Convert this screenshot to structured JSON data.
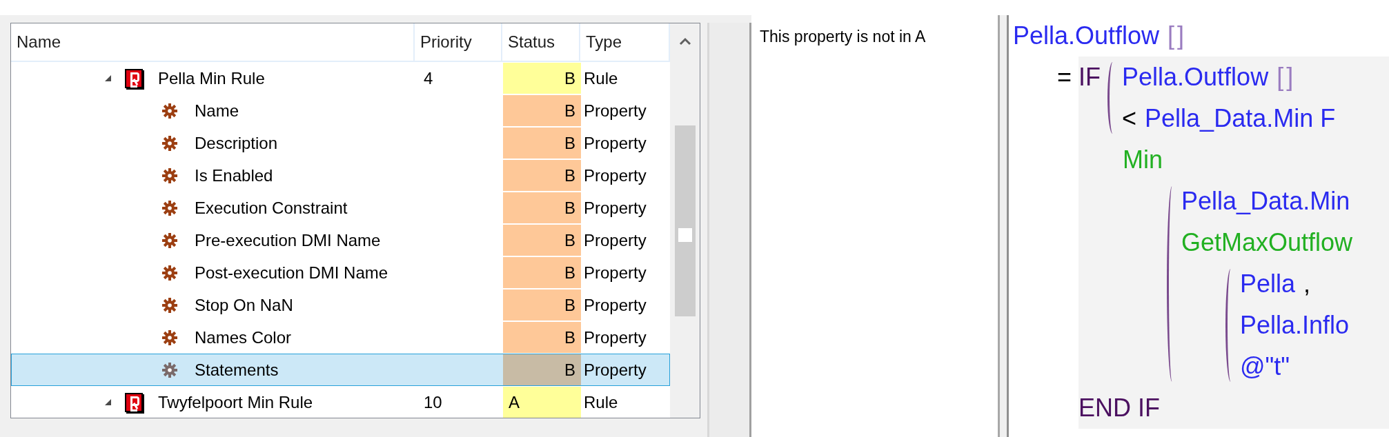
{
  "tree": {
    "columns": [
      "Name",
      "Priority",
      "Status",
      "Type"
    ],
    "rows": [
      {
        "kind": "rule",
        "name": "Pella Min Rule",
        "priority": "4",
        "status": {
          "text": "B",
          "aligned_right": true
        },
        "color": "#ffff99",
        "type": "Rule",
        "expanded": true,
        "selected": false,
        "children": [
          {
            "kind": "property",
            "name": "Name",
            "status": {
              "text": "B",
              "aligned_right": true
            },
            "color": "#fec898",
            "type": "Property",
            "selected": false
          },
          {
            "kind": "property",
            "name": "Description",
            "status": {
              "text": "B",
              "aligned_right": true
            },
            "color": "#fec898",
            "type": "Property",
            "selected": false
          },
          {
            "kind": "property",
            "name": "Is Enabled",
            "status": {
              "text": "B",
              "aligned_right": true
            },
            "color": "#fec898",
            "type": "Property",
            "selected": false
          },
          {
            "kind": "property",
            "name": "Execution Constraint",
            "status": {
              "text": "B",
              "aligned_right": true
            },
            "color": "#fec898",
            "type": "Property",
            "selected": false
          },
          {
            "kind": "property",
            "name": "Pre-execution DMI Name",
            "status": {
              "text": "B",
              "aligned_right": true
            },
            "color": "#fec898",
            "type": "Property",
            "selected": false
          },
          {
            "kind": "property",
            "name": "Post-execution DMI Name",
            "status": {
              "text": "B",
              "aligned_right": true
            },
            "color": "#fec898",
            "type": "Property",
            "selected": false
          },
          {
            "kind": "property",
            "name": "Stop On NaN",
            "status": {
              "text": "B",
              "aligned_right": true
            },
            "color": "#fec898",
            "type": "Property",
            "selected": false
          },
          {
            "kind": "property",
            "name": "Names Color",
            "status": {
              "text": "B",
              "aligned_right": true
            },
            "color": "#fec898",
            "type": "Property",
            "selected": false
          },
          {
            "kind": "property",
            "name": "Statements",
            "status": {
              "text": "B",
              "aligned_right": true
            },
            "color": "#c8bba5",
            "type": "Property",
            "selected": true
          }
        ]
      },
      {
        "kind": "rule",
        "name": "Twyfelpoort Min Rule",
        "priority": "10",
        "status": {
          "text": "A",
          "aligned_right": false
        },
        "color": "#ffff99",
        "type": "Rule",
        "expanded": true,
        "selected": false,
        "children": []
      }
    ]
  },
  "description": "This property is not in A",
  "formula": [
    {
      "kind": "line",
      "tokens": [
        {
          "text": "Pella.Outflow",
          "kind": "identifier"
        },
        {
          "text": "[]",
          "kind": "bracket"
        }
      ]
    },
    {
      "kind": "row",
      "children": [
        {
          "kind": "line",
          "tokens": [
            {
              "text": "=",
              "kind": "operator"
            }
          ]
        },
        {
          "kind": "scope",
          "children": [
            {
              "kind": "row",
              "children": [
                {
                  "kind": "line",
                  "tokens": [
                    {
                      "text": "IF",
                      "kind": "keyword"
                    }
                  ]
                },
                {
                  "kind": "paren",
                  "children": [
                    {
                      "kind": "line",
                      "tokens": [
                        {
                          "text": "Pella.Outflow",
                          "kind": "identifier"
                        },
                        {
                          "text": "[]",
                          "kind": "bracket"
                        }
                      ]
                    },
                    {
                      "kind": "line",
                      "tokens": [
                        {
                          "text": "<",
                          "kind": "operator"
                        },
                        {
                          "text": "Pella_Data.Min F",
                          "kind": "identifier"
                        }
                      ]
                    }
                  ]
                }
              ]
            },
            {
              "kind": "indent",
              "children": [
                {
                  "kind": "line",
                  "tokens": [
                    {
                      "text": "Min",
                      "kind": "function"
                    }
                  ]
                },
                {
                  "kind": "indent",
                  "children": [
                    {
                      "kind": "paren",
                      "children": [
                        {
                          "kind": "line",
                          "tokens": [
                            {
                              "text": "Pella_Data.Min",
                              "kind": "identifier"
                            }
                          ]
                        },
                        {
                          "kind": "line",
                          "tokens": [
                            {
                              "text": "GetMaxOutflow",
                              "kind": "function"
                            }
                          ]
                        },
                        {
                          "kind": "indent",
                          "children": [
                            {
                              "kind": "paren",
                              "children": [
                                {
                                  "kind": "line",
                                  "tokens": [
                                    {
                                      "text": "Pella",
                                      "kind": "identifier"
                                    },
                                    {
                                      "text": ",",
                                      "kind": "operator"
                                    }
                                  ]
                                },
                                {
                                  "kind": "line",
                                  "tokens": [
                                    {
                                      "text": "Pella.Inflo",
                                      "kind": "identifier"
                                    }
                                  ]
                                },
                                {
                                  "kind": "line",
                                  "tokens": [
                                    {
                                      "text": "@\"t\"",
                                      "kind": "string"
                                    }
                                  ]
                                }
                              ]
                            }
                          ]
                        }
                      ]
                    }
                  ]
                }
              ]
            },
            {
              "kind": "line",
              "tokens": [
                {
                  "text": "END IF",
                  "kind": "keyword"
                }
              ]
            }
          ]
        }
      ]
    }
  ]
}
